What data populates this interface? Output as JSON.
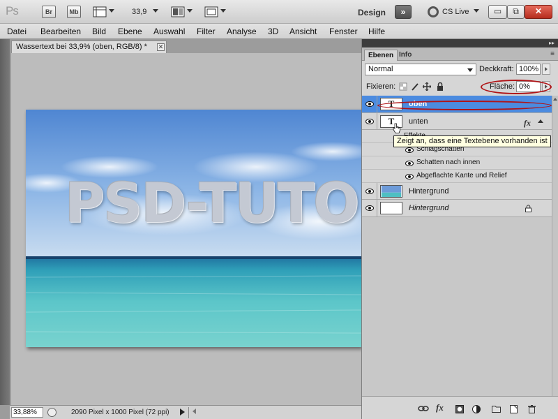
{
  "app": {
    "logo_text": "Ps",
    "bridge_label": "Br",
    "minibridge_label": "Mb",
    "zoom_value": "33,9",
    "workspace_label": "Design",
    "workspace_more": "»",
    "cslive_label": "CS Live",
    "win_minimize": "▭",
    "win_restore": "⧉",
    "win_close": "✕"
  },
  "menu": [
    "Datei",
    "Bearbeiten",
    "Bild",
    "Ebene",
    "Auswahl",
    "Filter",
    "Analyse",
    "3D",
    "Ansicht",
    "Fenster",
    "Hilfe"
  ],
  "document": {
    "tab_title": "Wassertext bei 33,9% (oben, RGB/8) *",
    "tab_close": "✕",
    "canvas_text": "PSD-TUTORIALS",
    "status": {
      "zoom": "33,88%",
      "size": "2090 Pixel x 1000 Pixel (72 ppi)"
    }
  },
  "panel": {
    "tabs": [
      "Ebenen",
      "Info"
    ],
    "menu_icon": "≡",
    "collapse_icon": "▸▸",
    "blend_mode": "Normal",
    "opacity_label": "Deckkraft:",
    "opacity_value": "100%",
    "lock_label": "Fixieren:",
    "fill_label": "Fläche:",
    "fill_value": "0%",
    "layers": [
      {
        "name": "oben",
        "type": "text",
        "thumb": "T",
        "selected": true
      },
      {
        "name": "unten",
        "type": "text",
        "thumb": "T",
        "fx": "fx"
      },
      {
        "name": "Hintergrund",
        "type": "image"
      },
      {
        "name": "Hintergrund",
        "type": "locked"
      }
    ],
    "effects_header": "Effekte",
    "effects": [
      "Schlagschatten",
      "Schatten nach innen",
      "Abgeflachte Kante und Relief"
    ],
    "tooltip": "Zeigt an, dass eine Textebene vorhanden ist",
    "footer_icons": [
      "link-icon",
      "fx-icon",
      "mask-icon",
      "adjustment-icon",
      "folder-icon",
      "new-layer-icon",
      "trash-icon"
    ]
  },
  "colors": {
    "selection_blue": "#4b8be0",
    "highlight_red": "#b01417",
    "tooltip_bg": "#ffffe1"
  }
}
